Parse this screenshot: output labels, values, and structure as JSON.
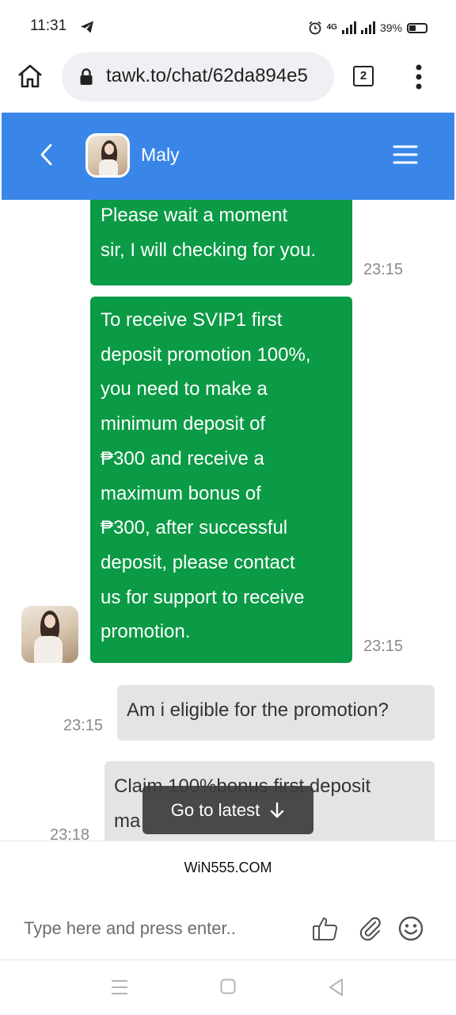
{
  "status_bar": {
    "time": "11:31",
    "network_label": "4G",
    "battery": "39%",
    "icons": [
      "telegram-icon",
      "alarm-icon",
      "signal-icon",
      "battery-icon"
    ]
  },
  "browser": {
    "url": "tawk.to/chat/62da894e5",
    "tab_count": "2",
    "icons": [
      "home-icon",
      "lock-icon",
      "menu-dots-icon"
    ]
  },
  "chat_header": {
    "agent_name": "Maly",
    "color": "#3a86e8"
  },
  "messages": [
    {
      "sender": "agent",
      "lines": [
        "Please wait a moment",
        "sir, I will checking for you."
      ],
      "time": "23:15"
    },
    {
      "sender": "agent",
      "lines": [
        "To receive SVIP1 first",
        "deposit promotion 100%,",
        "you need to make a",
        "minimum deposit of",
        "₱300 and receive a",
        "maximum bonus of",
        "₱300, after successful",
        "deposit, please contact",
        "us for support to receive",
        "promotion."
      ],
      "time": "23:15"
    },
    {
      "sender": "user",
      "lines": [
        "Am i eligible for the promotion?"
      ],
      "time": "23:15"
    },
    {
      "sender": "user",
      "lines": [
        "Claim 100%bonus first deposit",
        "ma"
      ],
      "time": "23:18"
    }
  ],
  "go_to_latest_label": "Go to latest",
  "brand_footer": "WiN555.COM",
  "composer": {
    "placeholder": "Type here and press enter.."
  },
  "colors": {
    "agent_bubble": "#0b9a45",
    "user_bubble": "#e4e4e4",
    "header": "#3a86e8"
  }
}
